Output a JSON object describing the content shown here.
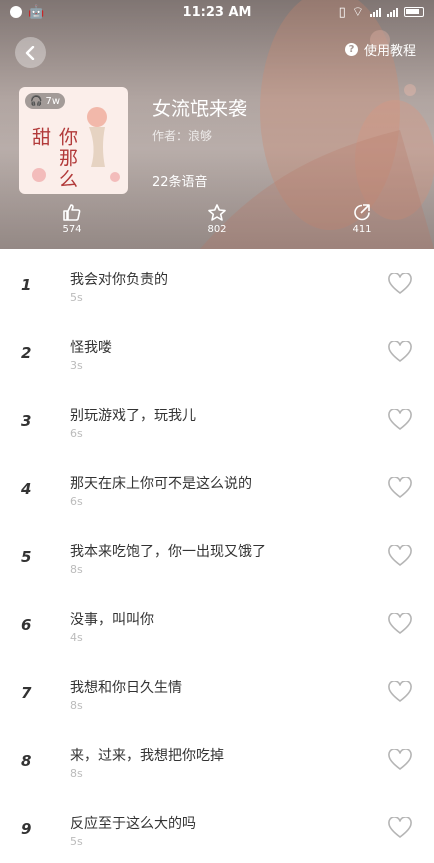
{
  "status_bar": {
    "time": "11:23 AM"
  },
  "header": {
    "help_label": "使用教程",
    "title": "女流氓来袭",
    "author": "作者：浪够",
    "count_label": "22条语音",
    "cover_badge": "7w",
    "cover_title": "你那么甜",
    "stats": {
      "likes": "574",
      "favorites": "802",
      "shares": "411"
    }
  },
  "items": [
    {
      "num": "1",
      "name": "我会对你负责的",
      "duration": "5s"
    },
    {
      "num": "2",
      "name": "怪我喽",
      "duration": "3s"
    },
    {
      "num": "3",
      "name": "别玩游戏了，玩我儿",
      "duration": "6s"
    },
    {
      "num": "4",
      "name": "那天在床上你可不是这么说的",
      "duration": "6s"
    },
    {
      "num": "5",
      "name": "我本来吃饱了，你一出现又饿了",
      "duration": "8s"
    },
    {
      "num": "6",
      "name": "没事，叫叫你",
      "duration": "4s"
    },
    {
      "num": "7",
      "name": "我想和你日久生情",
      "duration": "8s"
    },
    {
      "num": "8",
      "name": "来，过来，我想把你吃掉",
      "duration": "8s"
    },
    {
      "num": "9",
      "name": "反应至于这么大的吗",
      "duration": "5s"
    }
  ]
}
